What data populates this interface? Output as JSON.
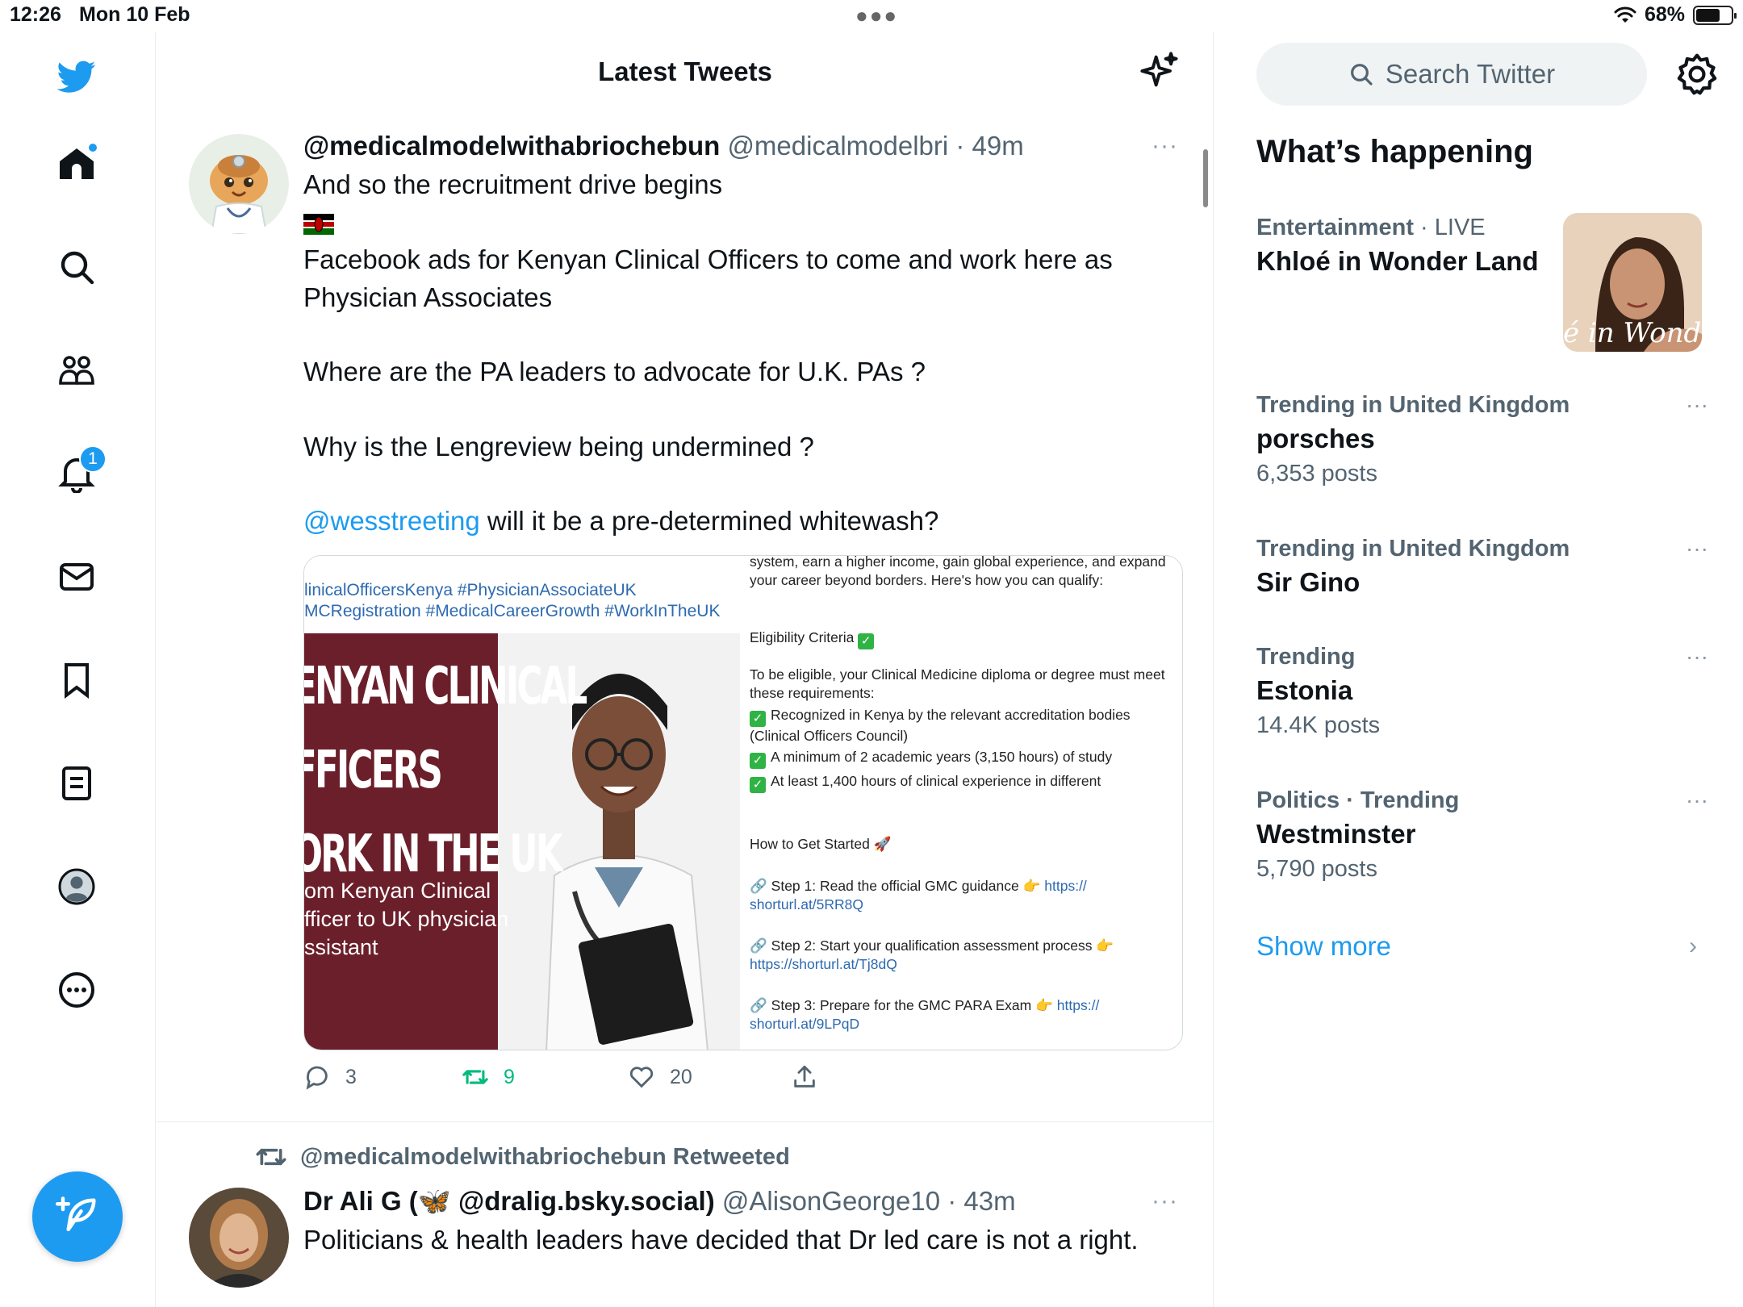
{
  "status_bar": {
    "time": "12:26",
    "date": "Mon 10 Feb",
    "battery": "68%",
    "battery_level": 0.68
  },
  "sidebar": {
    "notifications_badge": "1"
  },
  "header": {
    "title": "Latest Tweets"
  },
  "tweets": [
    {
      "display_name": "@medicalmodelwithabriochebun",
      "handle": "@medicalmodelbri",
      "time": "· 49m",
      "more": "···",
      "lines": {
        "l1": "And so the recruitment drive begins",
        "l3": "Facebook ads for Kenyan Clinical Officers to come and work here as Physician Associates",
        "l4": "Where are the PA leaders to advocate for U.K. PAs ?",
        "l5": "Why is the Lengreview being undermined ?",
        "mention": "@wesstreeting",
        "l6_rest": " will it be a pre-determined whitewash?"
      },
      "media": {
        "hashtag_line1": "linicalOfficersKenya #PhysicianAssociateUK",
        "hashtag_line2": "MCRegistration #MedicalCareerGrowth #WorkInTheUK",
        "poster_title_1": "ENYAN CLINICAL",
        "poster_title_2": "FFICERS",
        "poster_title_3": "ORK IN THE UK",
        "poster_sub_1": "om Kenyan Clinical",
        "poster_sub_2": "fficer to UK physician",
        "poster_sub_3": "ssistant",
        "intro": "system, earn a higher income, gain global experience, and expand your career beyond borders. Here's how you can qualify:",
        "eligibility": "Eligibility Criteria",
        "requirements": "To be eligible, your Clinical Medicine diploma or degree must meet these requirements:",
        "req1": "Recognized in Kenya by the relevant accreditation bodies (Clinical Officers Council)",
        "req2": "A minimum of 2 academic years (3,150 hours) of study",
        "req3": "At least 1,400 hours of clinical experience in different",
        "how": "How to Get Started 🚀",
        "step1": "Step 1: Read the official GMC guidance 👉",
        "step1_link": "https:// shorturl.at/5RR8Q",
        "step2": "Step 2: Start your qualification assessment process 👉",
        "step2_link": "https://shorturl.at/Tj8dQ",
        "step3": "Step 3: Prepare for the GMC PARA Exam 👉",
        "step3_link": "https:// shorturl.at/9LPqD"
      },
      "replies": "3",
      "retweets": "9",
      "likes": "20"
    },
    {
      "retweeted_by": "@medicalmodelwithabriochebun Retweeted",
      "display_name": "Dr Ali G (🦋 @dralig.bsky.social)",
      "handle": "@AlisonGeorge10",
      "time": "· 43m",
      "more": "···",
      "text": "Politicians & health leaders have decided that Dr led care is not a right."
    }
  ],
  "right": {
    "search_placeholder": "Search Twitter",
    "whats_happening": "What’s happening",
    "trends": [
      {
        "category": "Entertainment",
        "live": "· LIVE",
        "name": "Khloé in Wonder Land",
        "image_caption": "é in WonderL"
      },
      {
        "category": "Trending in United Kingdom",
        "name": "porsches",
        "count": "6,353 posts",
        "more": "···"
      },
      {
        "category": "Trending in United Kingdom",
        "name": "Sir Gino",
        "more": "···"
      },
      {
        "category": "Trending",
        "name": "Estonia",
        "count": "14.4K posts",
        "more": "···"
      },
      {
        "category": "Politics · Trending",
        "name": "Westminster",
        "count": "5,790 posts",
        "more": "···"
      }
    ],
    "show_more": "Show more"
  }
}
